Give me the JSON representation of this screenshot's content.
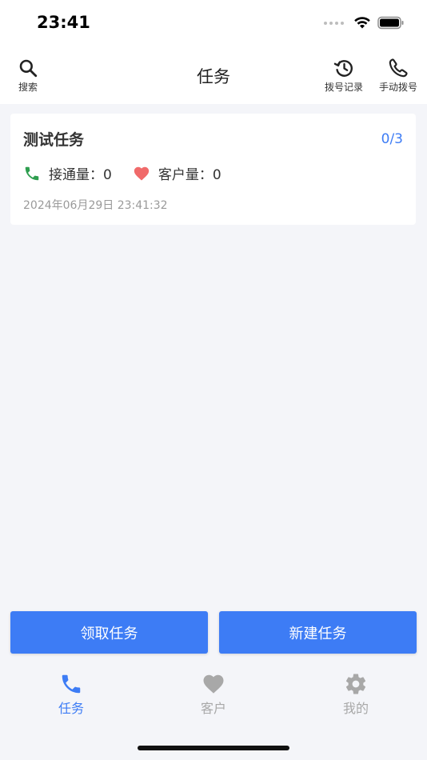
{
  "status_bar": {
    "time": "23:41"
  },
  "header": {
    "title": "任务",
    "search_label": "搜索",
    "history_label": "拨号记录",
    "manual_dial_label": "手动拨号"
  },
  "task": {
    "title": "测试任务",
    "progress": "0/3",
    "connected_label": "接通量：0",
    "customer_label": "客户量：0",
    "date": "2024年06月29日 23:41:32"
  },
  "actions": {
    "claim_label": "领取任务",
    "create_label": "新建任务"
  },
  "tabs": [
    {
      "label": "任务",
      "icon": "phone-icon",
      "active": true
    },
    {
      "label": "客户",
      "icon": "heart-icon",
      "active": false
    },
    {
      "label": "我的",
      "icon": "gear-icon",
      "active": false
    }
  ],
  "colors": {
    "accent": "#3d7cf5",
    "phone_green": "#2e9e4f",
    "heart_red": "#f06a6a",
    "inactive_gray": "#a8a8a8",
    "background": "#f4f5f9"
  }
}
